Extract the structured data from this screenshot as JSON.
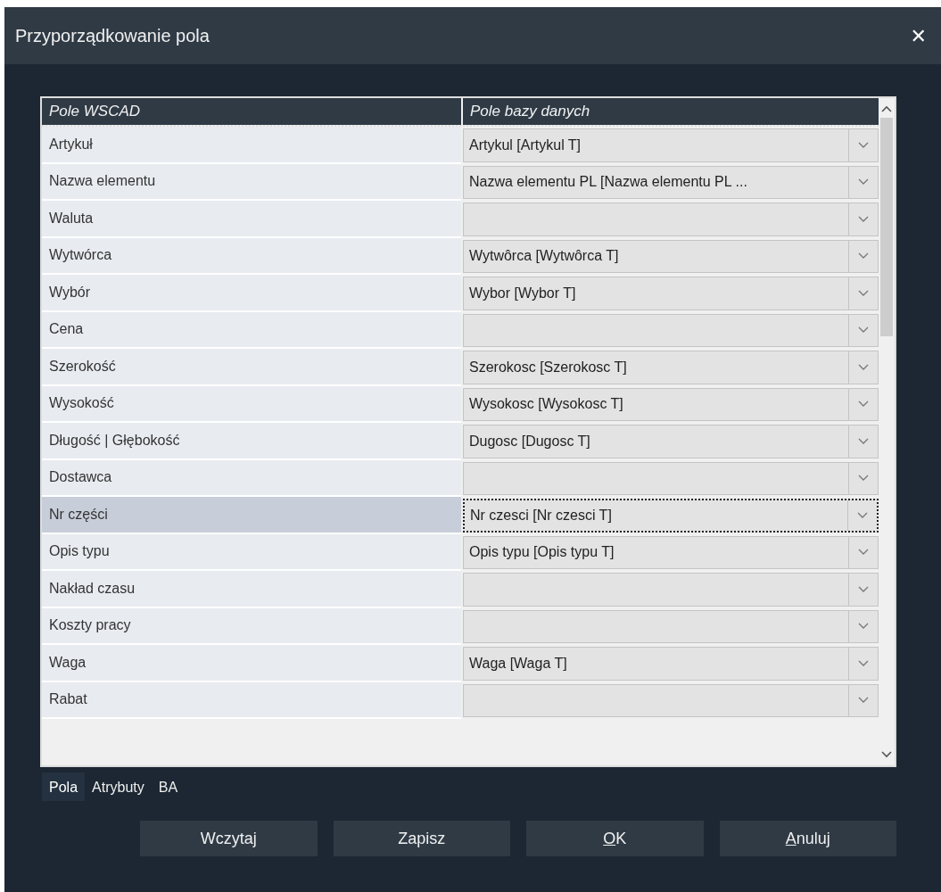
{
  "window": {
    "title": "Przyporządkowanie pola",
    "close": "✕"
  },
  "table": {
    "columns": [
      "Pole WSCAD",
      "Pole bazy danych"
    ],
    "rows": [
      {
        "field": "Artykuł",
        "value": "Artykul [Artykul T]",
        "selected": false
      },
      {
        "field": "Nazwa elementu",
        "value": "Nazwa elementu PL [Nazwa elementu PL ...",
        "selected": false
      },
      {
        "field": "Waluta",
        "selected": false
      },
      {
        "field": "Wytwórca",
        "value": "Wytwôrca [Wytwôrca T]",
        "selected": false
      },
      {
        "field": "Wybór",
        "value": "Wybor [Wybor T]",
        "selected": false
      },
      {
        "field": "Cena",
        "selected": false
      },
      {
        "field": "Szerokość",
        "value": "Szerokosc [Szerokosc T]",
        "selected": false
      },
      {
        "field": "Wysokość",
        "value": "Wysokosc [Wysokosc T]",
        "selected": false
      },
      {
        "field": "Długość | Głębokość",
        "value": "Dugosc [Dugosc T]",
        "selected": false
      },
      {
        "field": "Dostawca",
        "selected": false
      },
      {
        "field": "Nr części",
        "value": "Nr czesci [Nr czesci T]",
        "selected": true
      },
      {
        "field": "Opis typu",
        "value": "Opis typu [Opis typu T]",
        "selected": false
      },
      {
        "field": "Nakład czasu",
        "selected": false
      },
      {
        "field": "Koszty pracy",
        "selected": false
      },
      {
        "field": "Waga",
        "value": "Waga [Waga T]",
        "selected": false
      },
      {
        "field": "Rabat",
        "selected": false
      }
    ]
  },
  "tabs": [
    {
      "label": "Pola",
      "selected": true
    },
    {
      "label": "Atrybuty",
      "selected": false
    },
    {
      "label": "BA",
      "selected": false
    }
  ],
  "buttons": [
    {
      "label": "Wczytaj",
      "underline_first": false
    },
    {
      "label": "Zapisz",
      "underline_first": false
    },
    {
      "label": "OK",
      "underline_first": true
    },
    {
      "label": "Anuluj",
      "underline_first": true
    }
  ]
}
